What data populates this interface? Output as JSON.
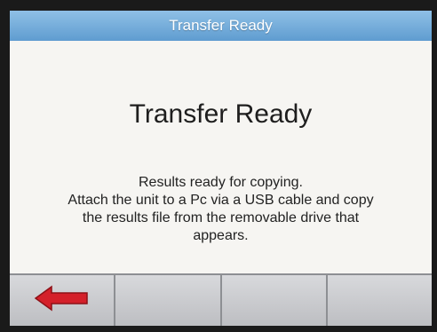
{
  "window": {
    "title": "Transfer Ready"
  },
  "main": {
    "heading": "Transfer Ready",
    "message_lines": [
      "Results ready for copying.",
      "Attach the unit to a Pc via a USB cable and copy",
      "the results file from the removable drive that",
      "appears."
    ]
  },
  "softkeys": [
    {
      "icon": "back-arrow-icon",
      "color": "#d4202a"
    },
    {
      "label": ""
    },
    {
      "label": ""
    },
    {
      "label": ""
    }
  ]
}
